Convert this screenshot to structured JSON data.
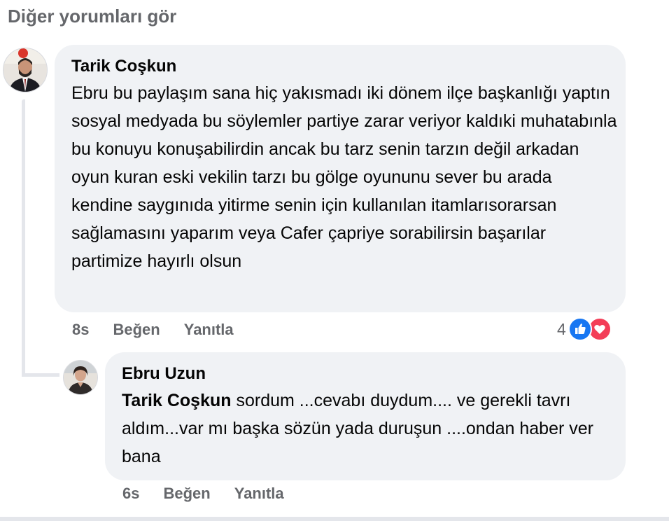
{
  "see_more_label": "Diğer yorumları gör",
  "comments": [
    {
      "author": "Tarik Coşkun",
      "avatar_icon": "profile-photo",
      "text": "Ebru bu paylaşım sana hiç yakısmadı iki dönem ilçe başkanlığı yaptın sosyal medyada bu söylemler partiye zarar veriyor kaldıki muhatabınla bu konuyu konuşabilirdin ancak bu tarz senin tarzın değil arkadan oyun kuran eski vekilin tarzı bu gölge oyununu sever bu arada kendine saygınıda yitirme senin için kullanılan itamlarısorarsan sağlamasını yaparım veya Cafer çapriye sorabilirsin başarılar partimize hayırlı olsun",
      "time": "8s",
      "like_label": "Beğen",
      "reply_label": "Yanıtla",
      "reaction_count": "4",
      "reactions": [
        "like-icon",
        "love-icon"
      ]
    }
  ],
  "reply": {
    "author": "Ebru Uzun",
    "avatar_icon": "profile-photo",
    "mention": "Tarik Coşkun",
    "text": " sordum ...cevabı duydum.... ve gerekli tavrı aldım...var mı başka sözün yada duruşun ....ondan haber ver bana",
    "time": "6s",
    "like_label": "Beğen",
    "reply_label": "Yanıtla"
  },
  "colors": {
    "bubble_bg": "#f0f2f5",
    "secondary_text": "#65676b",
    "like_blue": "#1877f2",
    "love_red": "#f33e58"
  }
}
